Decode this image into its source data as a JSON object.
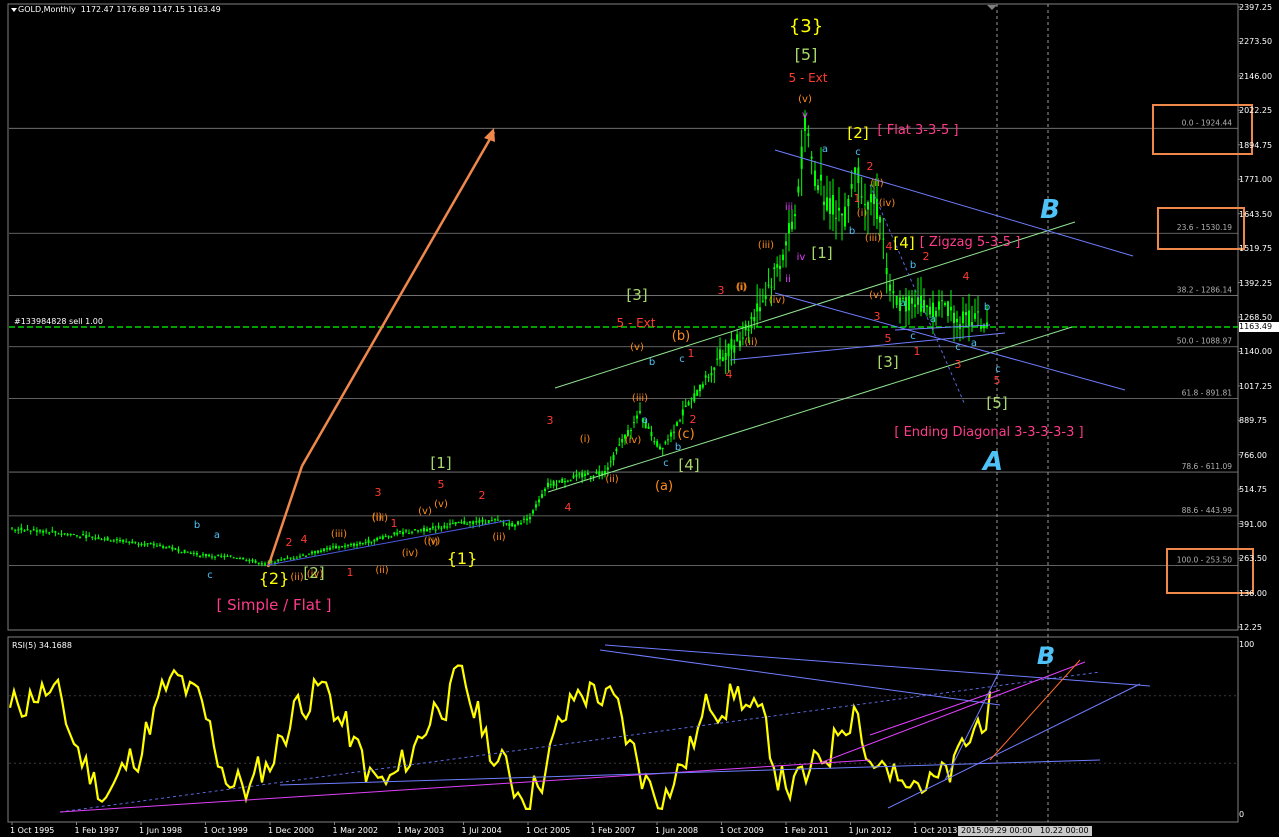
{
  "window": {
    "symbol": "GOLD,Monthly",
    "ohlc": "1172.47 1176.89 1147.15 1163.49",
    "order_label": "#133984828 sell 1.00",
    "current_price": "1163.49",
    "rsi_label": "RSI(5) 34.1688",
    "crosshair_label": "2015.09.29 00:00",
    "crosshair_label2": "10.22 00:00"
  },
  "colors": {
    "background": "#000000",
    "bull_candle": "#00ff00",
    "rsi_line": "#ffff00",
    "fib_line": "#808080",
    "price_line": "#00ff00",
    "arrow": "#f0884c",
    "box": "#f0884c",
    "label_yellow": "#ffff00",
    "label_green": "#a6d96a",
    "label_red": "#ff3b30",
    "label_orange": "#ff8c1a",
    "label_cyan": "#4fc3f7",
    "label_pink": "#ff3b8b",
    "label_magenta": "#e040fb",
    "trend_blue": "#6f7dff",
    "trend_green": "#8fe38f",
    "trend_magenta": "#e040fb"
  },
  "price_axis": [
    "2397.25",
    "2273.50",
    "2146.00",
    "2022.25",
    "1894.75",
    "1771.00",
    "1643.50",
    "1519.75",
    "1392.25",
    "1268.50",
    "1140.00",
    "1017.25",
    "889.75",
    "766.00",
    "514.75",
    "391.00",
    "263.50",
    "136.00",
    "12.25"
  ],
  "rsi_axis": [
    "100",
    "0"
  ],
  "time_axis": [
    "1 Oct 1995",
    "1 Feb 1997",
    "1 Jun 1998",
    "1 Oct 1999",
    "1 Dec 2000",
    "1 Mar 2002",
    "1 May 2003",
    "1 Jul 2004",
    "1 Oct 2005",
    "1 Feb 2007",
    "1 Jun 2008",
    "1 Oct 2009",
    "1 Feb 2011",
    "1 Jun 2012",
    "1 Oct 2013"
  ],
  "fib_levels": [
    {
      "label": "0.0 - 1924.44",
      "value": 1924.44
    },
    {
      "label": "23.6 - 1530.19",
      "value": 1530.19
    },
    {
      "label": "38.2 - 1286.14",
      "value": 1286.14
    },
    {
      "label": "50.0 - 1088.97",
      "value": 1088.97
    },
    {
      "label": "61.8 - 891.81",
      "value": 891.81
    },
    {
      "label": "78.6 - 611.09",
      "value": 611.09
    },
    {
      "label": "88.6 - 443.99",
      "value": 443.99
    },
    {
      "label": "100.0 - 253.50",
      "value": 253.5
    }
  ],
  "wave_labels": [
    {
      "t": "{3}",
      "c": "label_yellow",
      "s": 18
    },
    {
      "t": "[5]",
      "c": "label_green",
      "s": 16
    },
    {
      "t": "5 - Ext",
      "c": "label_red",
      "s": 12
    },
    {
      "t": "(v)",
      "c": "label_orange",
      "s": 10
    },
    {
      "t": "v",
      "c": "label_magenta",
      "s": 10
    },
    {
      "t": "[2]",
      "c": "label_yellow",
      "s": 15
    },
    {
      "t": "[ Flat 3-3-5 ]",
      "c": "label_pink",
      "s": 13
    },
    {
      "t": "a",
      "c": "label_cyan",
      "s": 10
    },
    {
      "t": "c",
      "c": "label_cyan",
      "s": 10
    },
    {
      "t": "2",
      "c": "label_red",
      "s": 11
    },
    {
      "t": "(ii)",
      "c": "label_orange",
      "s": 10
    },
    {
      "t": "1",
      "c": "label_red",
      "s": 11
    },
    {
      "t": "(i)",
      "c": "label_orange",
      "s": 10
    },
    {
      "t": "(iv)",
      "c": "label_orange",
      "s": 10
    },
    {
      "t": "iii",
      "c": "label_magenta",
      "s": 10
    },
    {
      "t": "b",
      "c": "label_cyan",
      "s": 10
    },
    {
      "t": "(iii)",
      "c": "label_orange",
      "s": 10
    },
    {
      "t": "iv",
      "c": "label_magenta",
      "s": 10
    },
    {
      "t": "[1]",
      "c": "label_green",
      "s": 15
    },
    {
      "t": "[4]",
      "c": "label_yellow",
      "s": 15
    },
    {
      "t": "[ Zigzag 5-3-5 ]",
      "c": "label_pink",
      "s": 13
    },
    {
      "t": "4",
      "c": "label_red",
      "s": 11
    },
    {
      "t": "2",
      "c": "label_red",
      "s": 11
    },
    {
      "t": "b",
      "c": "label_cyan",
      "s": 10
    },
    {
      "t": "4",
      "c": "label_red",
      "s": 11
    },
    {
      "t": "(iii)",
      "c": "label_orange",
      "s": 10
    },
    {
      "t": "ii",
      "c": "label_magenta",
      "s": 10
    },
    {
      "t": "(i)",
      "c": "label_orange",
      "s": 10
    },
    {
      "t": "(iv)",
      "c": "label_orange",
      "s": 10
    },
    {
      "t": "(v)",
      "c": "label_orange",
      "s": 10
    },
    {
      "t": "a",
      "c": "label_cyan",
      "s": 10
    },
    {
      "t": "a",
      "c": "label_cyan",
      "s": 10
    },
    {
      "t": "c",
      "c": "label_cyan",
      "s": 10
    },
    {
      "t": "3",
      "c": "label_red",
      "s": 11
    },
    {
      "t": "5",
      "c": "label_red",
      "s": 11
    },
    {
      "t": "1",
      "c": "label_red",
      "s": 11
    },
    {
      "t": "b",
      "c": "label_cyan",
      "s": 10
    },
    {
      "t": "c",
      "c": "label_cyan",
      "s": 10
    },
    {
      "t": "a",
      "c": "label_cyan",
      "s": 10
    },
    {
      "t": "c",
      "c": "label_cyan",
      "s": 10
    },
    {
      "t": "3",
      "c": "label_red",
      "s": 11
    },
    {
      "t": "5",
      "c": "label_red",
      "s": 11
    },
    {
      "t": "[3]",
      "c": "label_green",
      "s": 15
    },
    {
      "t": "[5]",
      "c": "label_green",
      "s": 15
    },
    {
      "t": "[ Ending Diagonal 3-3-3-3-3 ]",
      "c": "label_pink",
      "s": 13
    },
    {
      "t": "[3]",
      "c": "label_green",
      "s": 15
    },
    {
      "t": "5 - Ext",
      "c": "label_red",
      "s": 12
    },
    {
      "t": "(v)",
      "c": "label_orange",
      "s": 10
    },
    {
      "t": "3",
      "c": "label_red",
      "s": 11
    },
    {
      "t": "(i)",
      "c": "label_orange",
      "s": 10
    },
    {
      "t": "(b)",
      "c": "label_orange",
      "s": 13
    },
    {
      "t": "b",
      "c": "label_cyan",
      "s": 10
    },
    {
      "t": "c",
      "c": "label_cyan",
      "s": 10
    },
    {
      "t": "1",
      "c": "label_red",
      "s": 11
    },
    {
      "t": "(iii)",
      "c": "label_orange",
      "s": 10
    },
    {
      "t": "(ii)",
      "c": "label_orange",
      "s": 10
    },
    {
      "t": "4",
      "c": "label_red",
      "s": 11
    },
    {
      "t": "a",
      "c": "label_cyan",
      "s": 10
    },
    {
      "t": "2",
      "c": "label_red",
      "s": 11
    },
    {
      "t": "(c)",
      "c": "label_orange",
      "s": 13
    },
    {
      "t": "(iv)",
      "c": "label_orange",
      "s": 10
    },
    {
      "t": "(i)",
      "c": "label_orange",
      "s": 10
    },
    {
      "t": "3",
      "c": "label_red",
      "s": 11
    },
    {
      "t": "c",
      "c": "label_cyan",
      "s": 10
    },
    {
      "t": "b",
      "c": "label_cyan",
      "s": 10
    },
    {
      "t": "[4]",
      "c": "label_green",
      "s": 15
    },
    {
      "t": "(a)",
      "c": "label_orange",
      "s": 13
    },
    {
      "t": "(ii)",
      "c": "label_orange",
      "s": 10
    },
    {
      "t": "4",
      "c": "label_red",
      "s": 11
    },
    {
      "t": "[1]",
      "c": "label_green",
      "s": 15
    },
    {
      "t": "5",
      "c": "label_red",
      "s": 11
    },
    {
      "t": "(v)",
      "c": "label_orange",
      "s": 10
    },
    {
      "t": "3",
      "c": "label_red",
      "s": 11
    },
    {
      "t": "(iv)",
      "c": "label_orange",
      "s": 10
    },
    {
      "t": "(iii)",
      "c": "label_orange",
      "s": 10
    },
    {
      "t": "(iii)",
      "c": "label_orange",
      "s": 10
    },
    {
      "t": "(v)",
      "c": "label_orange",
      "s": 10
    },
    {
      "t": "(i)",
      "c": "label_orange",
      "s": 10
    },
    {
      "t": "1",
      "c": "label_red",
      "s": 11
    },
    {
      "t": "2",
      "c": "label_red",
      "s": 11
    },
    {
      "t": "(ii)",
      "c": "label_orange",
      "s": 10
    },
    {
      "t": "(iv)",
      "c": "label_orange",
      "s": 10
    },
    {
      "t": "(i)",
      "c": "label_orange",
      "s": 10
    },
    {
      "t": "4",
      "c": "label_red",
      "s": 11
    },
    {
      "t": "(ii)",
      "c": "label_orange",
      "s": 10
    },
    {
      "t": "(iv)",
      "c": "label_orange",
      "s": 10
    },
    {
      "t": "1",
      "c": "label_red",
      "s": 11
    },
    {
      "t": "2",
      "c": "label_red",
      "s": 11
    },
    {
      "t": "(ii)",
      "c": "label_orange",
      "s": 10
    },
    {
      "t": "[2]",
      "c": "label_green",
      "s": 15
    },
    {
      "t": "{1}",
      "c": "label_yellow",
      "s": 16
    },
    {
      "t": "b",
      "c": "label_cyan",
      "s": 10
    },
    {
      "t": "a",
      "c": "label_cyan",
      "s": 10
    },
    {
      "t": "c",
      "c": "label_cyan",
      "s": 10
    },
    {
      "t": "{2}",
      "c": "label_yellow",
      "s": 16
    },
    {
      "t": "[ Simple / Flat ]",
      "c": "label_pink",
      "s": 15
    }
  ],
  "script_labels": [
    {
      "t": "B",
      "c": "label_cyan",
      "s": 26,
      "where": "price"
    },
    {
      "t": "A",
      "c": "label_cyan",
      "s": 26,
      "where": "price"
    },
    {
      "t": "B",
      "c": "label_cyan",
      "s": 24,
      "where": "rsi"
    }
  ],
  "chart_data": {
    "type": "line",
    "title": "",
    "symbol": "GOLD,Monthly",
    "xlabel": "",
    "ylabel": "",
    "x": [
      "1995-10",
      "1997-02",
      "1998-06",
      "1999-10",
      "2000-12",
      "2002-03",
      "2003-05",
      "2004-07",
      "2005-10",
      "2007-02",
      "2008-06",
      "2009-10",
      "2011-02",
      "2012-06",
      "2013-10",
      "2015-09"
    ],
    "series": [
      {
        "values": [
          388,
          357,
          296,
          292,
          265,
          300,
          365,
          405,
          470,
          665,
          880,
          1050,
          1420,
          1590,
          1300,
          1163
        ]
      }
    ],
    "ylim": [
      12.25,
      2397.25
    ],
    "rsi": {
      "label": "RSI(5) 34.1688",
      "period": 5,
      "current": 34.1688,
      "ylim": [
        0,
        100
      ],
      "x": [
        "1995-10",
        "1997-02",
        "1998-06",
        "1999-10",
        "2000-12",
        "2002-03",
        "2003-05",
        "2004-07",
        "2005-10",
        "2007-02",
        "2008-06",
        "2009-10",
        "2011-02",
        "2012-06",
        "2013-10",
        "2015-09"
      ],
      "values": [
        72,
        18,
        45,
        30,
        50,
        28,
        68,
        42,
        55,
        90,
        35,
        58,
        75,
        12,
        45,
        34
      ]
    },
    "grid": true
  }
}
